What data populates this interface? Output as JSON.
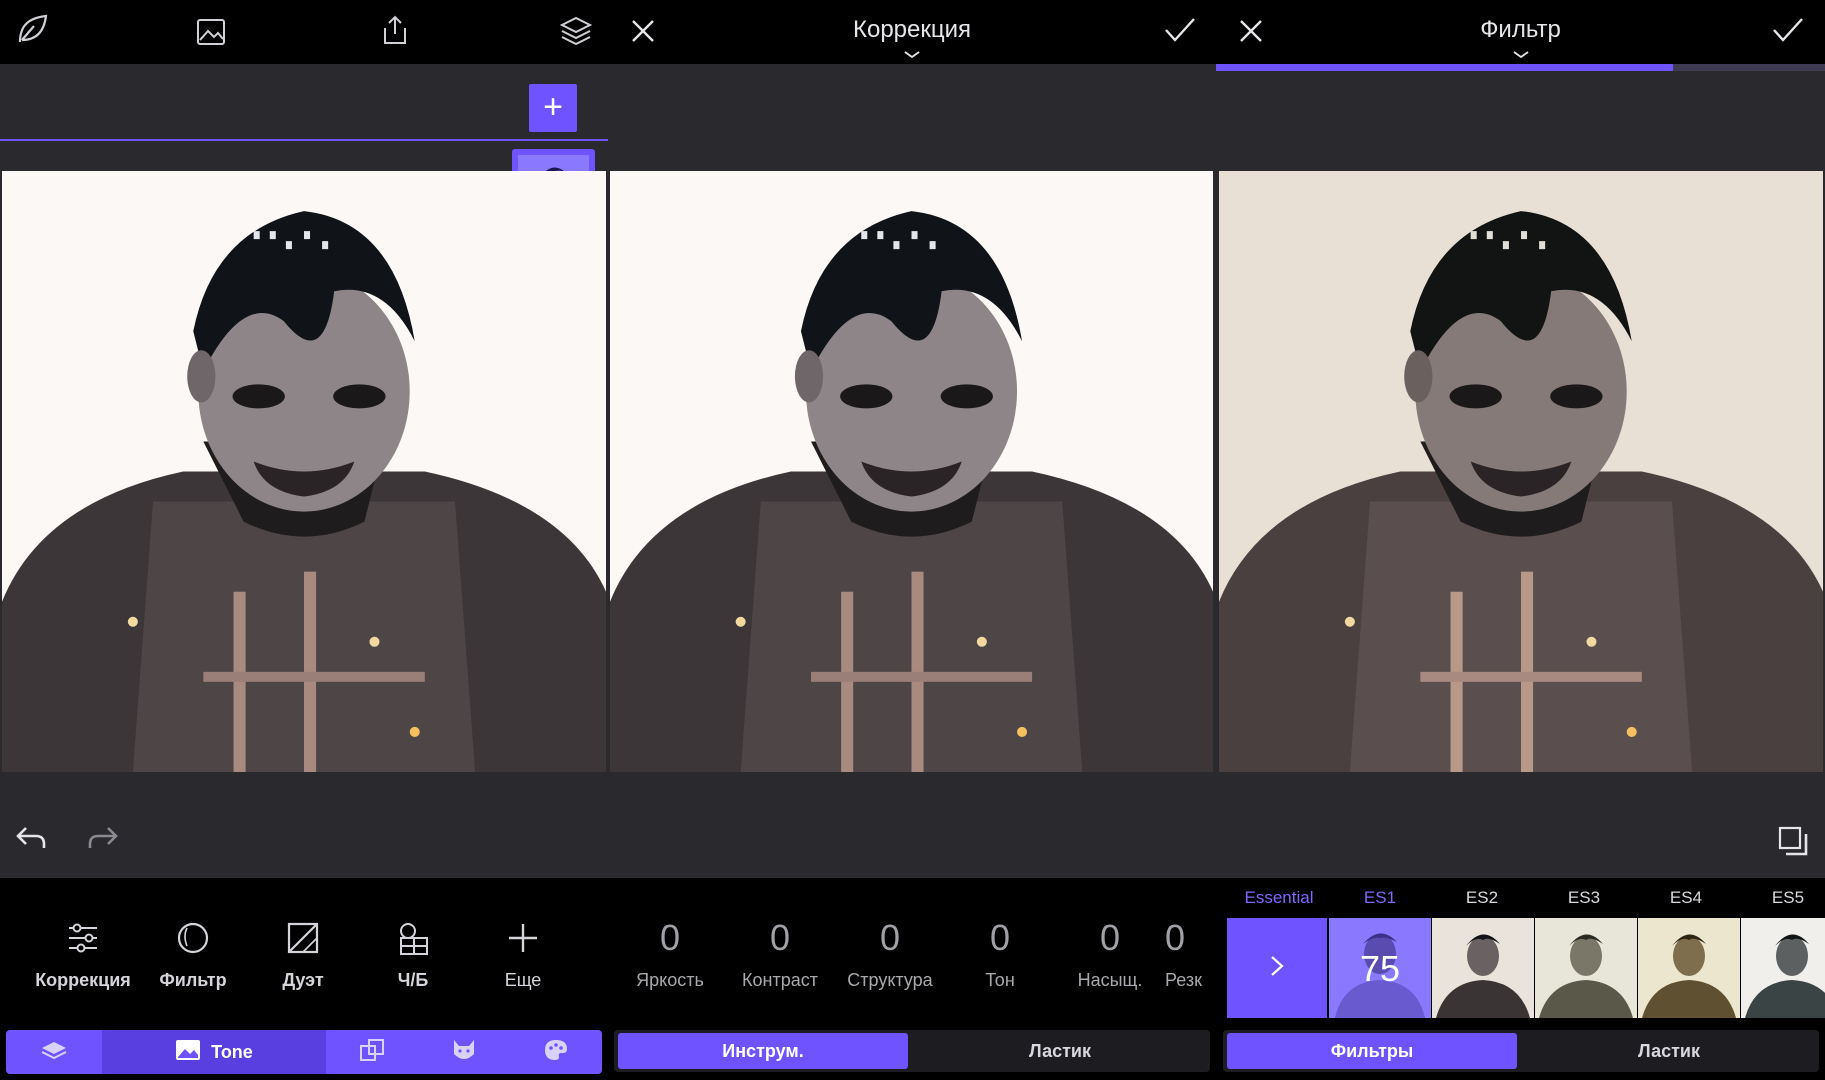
{
  "panel_left": {
    "add_label": "+",
    "tabs": {
      "tone_label": "Tone"
    },
    "tools": [
      {
        "label": "Коррекция"
      },
      {
        "label": "Фильтр"
      },
      {
        "label": "Дуэт"
      },
      {
        "label": "Ч/Б"
      },
      {
        "label": "Еще"
      }
    ]
  },
  "panel_middle": {
    "title": "Коррекция",
    "sliders": [
      {
        "value": "0",
        "label": "Яркость"
      },
      {
        "value": "0",
        "label": "Контраст"
      },
      {
        "value": "0",
        "label": "Структура"
      },
      {
        "value": "0",
        "label": "Тон"
      },
      {
        "value": "0",
        "label": "Насыщ."
      },
      {
        "value": "0",
        "label": "Резк"
      }
    ],
    "segments": {
      "tools_label": "Инструм.",
      "eraser_label": "Ластик"
    }
  },
  "panel_right": {
    "title": "Фильтр",
    "progress": 0.75,
    "filters": {
      "category": "Essential",
      "names": [
        "ES1",
        "ES2",
        "ES3",
        "ES4",
        "ES5"
      ],
      "active_value": "75"
    },
    "segments": {
      "filters_label": "Фильтры",
      "eraser_label": "Ластик"
    }
  },
  "colors": {
    "accent": "#6f53ff",
    "panel_bg": "#2a292e",
    "topbar_bg": "#000000"
  }
}
